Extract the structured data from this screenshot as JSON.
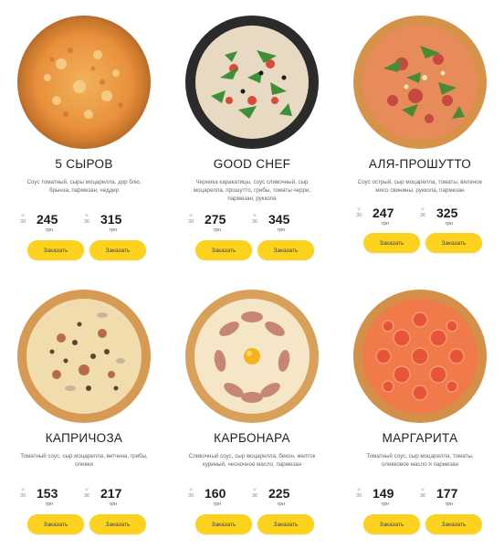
{
  "order_label": "Заказать",
  "currency": "грн",
  "pizzas": [
    {
      "name": "5 СЫРОВ",
      "description": "Соус томатный, сыры моцарелла, дор блю, брынза, пармезан, чеддер",
      "prices": [
        {
          "size": "30",
          "value": "245"
        },
        {
          "size": "36",
          "value": "315"
        }
      ]
    },
    {
      "name": "GOOD CHEF",
      "description": "Черника каракатицы, соус сливочный, сыр моцарелла, прошутто, грибы, томаты черри, пармезан, руккола",
      "prices": [
        {
          "size": "30",
          "value": "275"
        },
        {
          "size": "36",
          "value": "345"
        }
      ]
    },
    {
      "name": "АЛЯ-ПРОШУТТО",
      "description": "Соус острый, сыр моцарелла, томаты, вяленое мясо свинины, руккола, пармезан",
      "prices": [
        {
          "size": "30",
          "value": "247"
        },
        {
          "size": "36",
          "value": "325"
        }
      ]
    },
    {
      "name": "КАПРИЧОЗА",
      "description": "Томатный соус, сыр моцарелла, ветчина, грибы, оливки",
      "prices": [
        {
          "size": "30",
          "value": "153"
        },
        {
          "size": "36",
          "value": "217"
        }
      ]
    },
    {
      "name": "КАРБОНАРА",
      "description": "Сливочный соус, сыр моцарелла, бекон, желток куриный, чесночное масло, пармезан",
      "prices": [
        {
          "size": "30",
          "value": "160"
        },
        {
          "size": "36",
          "value": "225"
        }
      ]
    },
    {
      "name": "МАРГАРИТА",
      "description": "Томатный соус, сыр моцарелла, томаты, оливковое масло и пармезан",
      "prices": [
        {
          "size": "30",
          "value": "149"
        },
        {
          "size": "36",
          "value": "177"
        }
      ]
    }
  ],
  "colors": {
    "button": "#fcd21e",
    "crust": "#d99a4a"
  }
}
